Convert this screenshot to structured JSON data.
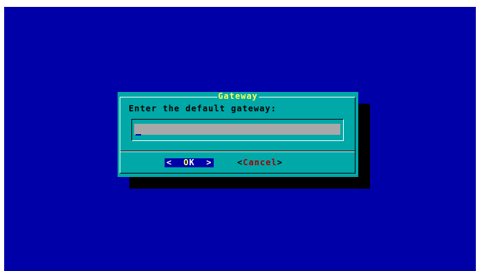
{
  "dialog": {
    "title": "Gateway",
    "prompt": "Enter the default gateway:",
    "input_value": "",
    "buttons": {
      "ok": {
        "left": "<",
        "hotkey": "O",
        "rest": "K",
        "right": ">"
      },
      "cancel": {
        "left": "<",
        "hotkey": "C",
        "rest": "ancel",
        "right": ">"
      }
    }
  },
  "colors": {
    "screen_background": "#0000a8",
    "dialog_background": "#00a8a8",
    "title_text": "#ffff54",
    "input_background": "#a8a8a8",
    "selected_button": "#0000a8"
  }
}
